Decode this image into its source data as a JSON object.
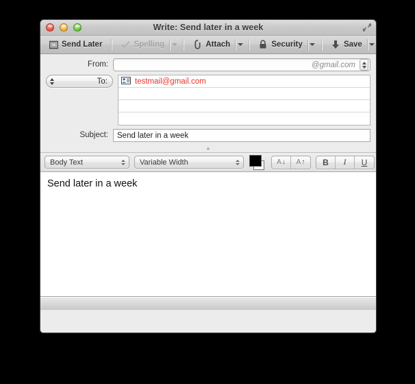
{
  "window": {
    "title": "Write: Send later in a week",
    "traffic_lights": [
      "close",
      "minimize",
      "zoom"
    ],
    "fullscreen_icon": "fullscreen-arrows-icon"
  },
  "toolbar": {
    "items": [
      {
        "label": "Send Later",
        "icon": "send-later-icon",
        "disabled": false,
        "has_menu": false
      },
      {
        "label": "Spelling",
        "icon": "checkmark-icon",
        "disabled": true,
        "has_menu": true
      },
      {
        "label": "Attach",
        "icon": "paperclip-icon",
        "disabled": false,
        "has_menu": true
      },
      {
        "label": "Security",
        "icon": "lock-icon",
        "disabled": false,
        "has_menu": true
      },
      {
        "label": "Save",
        "icon": "download-arrow-icon",
        "disabled": false,
        "has_menu": true
      }
    ]
  },
  "headers": {
    "from_label": "From:",
    "from_value": "@gmail.com",
    "recipient_type": "To:",
    "recipients": [
      {
        "address": "testmail@gmail.com",
        "icon": "contact-card-icon"
      },
      {
        "address": "",
        "icon": ""
      },
      {
        "address": "",
        "icon": ""
      },
      {
        "address": "",
        "icon": ""
      }
    ],
    "subject_label": "Subject:",
    "subject_value": "Send later in a week"
  },
  "format_bar": {
    "paragraph_style": "Body Text",
    "font_family": "Variable Width",
    "color_swatch": "#000000",
    "color_swatch_background": "#ffffff",
    "size_buttons": [
      {
        "name": "decrease-font-size",
        "glyph": "A",
        "arrow": "↓"
      },
      {
        "name": "increase-font-size",
        "glyph": "A",
        "arrow": "↑"
      }
    ],
    "style_buttons": [
      {
        "name": "bold",
        "label": "B"
      },
      {
        "name": "italic",
        "label": "I"
      },
      {
        "name": "underline",
        "label": "U"
      }
    ]
  },
  "body": {
    "text": "Send later in a week"
  },
  "colors": {
    "recipient_text": "#e8342a",
    "window_chrome": "#ececec",
    "desktop": "#000000"
  }
}
